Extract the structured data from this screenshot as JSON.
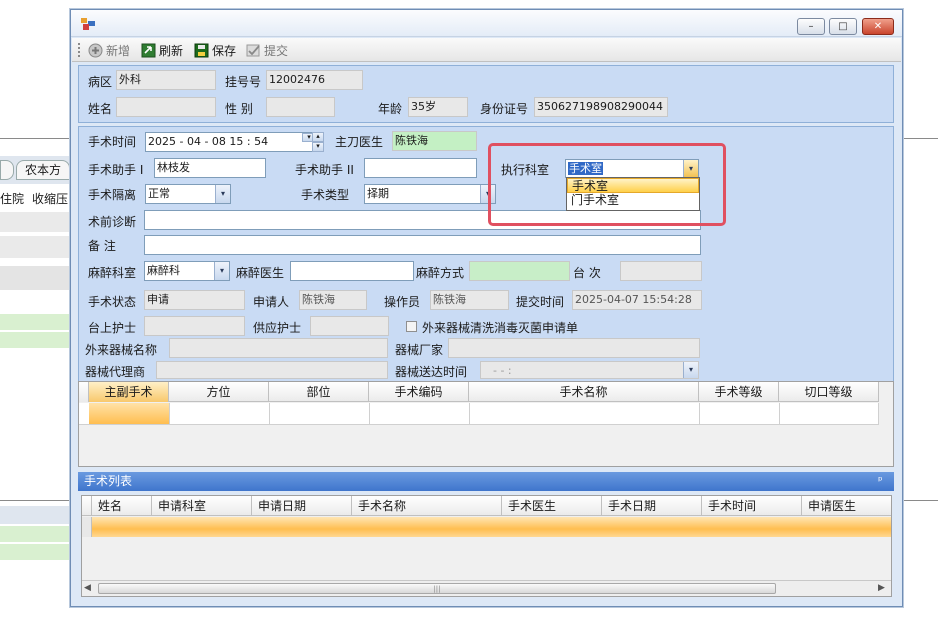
{
  "background": {
    "tab_label": "农本方",
    "row_labels": [
      "住院",
      "收缩压"
    ]
  },
  "window": {
    "controls": {
      "minimize": "–",
      "maximize": "□",
      "close": "✕"
    }
  },
  "toolbar": {
    "new_label": "新增",
    "refresh_label": "刷新",
    "save_label": "保存",
    "submit_label": "提交"
  },
  "patient": {
    "ward_label": "病区",
    "ward_value": "外科",
    "bed_label": "挂号号",
    "bed_value": "12002476",
    "name_label": "姓名",
    "name_value": "",
    "gender_label": "性  别",
    "gender_value": "",
    "age_label": "年龄",
    "age_value": "35岁",
    "id_label": "身份证号",
    "id_value": "350627198908290044"
  },
  "surgery": {
    "time_label": "手术时间",
    "time_value": "2025 - 04 - 08   15 : 54",
    "surgeon_label": "主刀医生",
    "surgeon_value": "陈铁海",
    "assistant1_label": "手术助手 I",
    "assistant1_value": "林枝发",
    "assistant2_label": "手术助手 II",
    "assistant2_value": "",
    "dept_label": "执行科室",
    "dept_value": "手术室",
    "dept_options": [
      "手术室",
      "门手术室"
    ],
    "isolation_label": "手术隔离",
    "isolation_value": "正常",
    "type_label": "手术类型",
    "type_value": "择期",
    "diagnosis_label": "术前诊断",
    "diagnosis_value": "",
    "remarks_label": "备    注",
    "remarks_value": "",
    "anes_dept_label": "麻醉科室",
    "anes_dept_value": "麻醉科",
    "anes_doctor_label": "麻醉医生",
    "anes_doctor_value": "",
    "anes_method_label": "麻醉方式",
    "anes_method_value": "",
    "table_no_label": "台  次",
    "table_no_value": "",
    "status_label": "手术状态",
    "status_value": "申请",
    "applicant_label": "申请人",
    "applicant_value": "陈铁海",
    "operator_label": "操作员",
    "operator_value": "陈铁海",
    "submit_time_label": "提交时间",
    "submit_time_value": "2025-04-07 15:54:28",
    "scrub_nurse_label": "台上护士",
    "scrub_nurse_value": "",
    "supply_nurse_label": "供应护士",
    "supply_nurse_value": "",
    "external_check_label": "外来器械清洗消毒灭菌申请单",
    "device_name_label": "外来器械名称",
    "device_name_value": "",
    "manufacturer_label": "器械厂家",
    "manufacturer_value": "",
    "agent_label": "器械代理商",
    "agent_value": "",
    "delivery_time_label": "器械送达时间",
    "delivery_time_value": "-  -    :"
  },
  "surgery_grid": {
    "columns": [
      "主副手术",
      "方位",
      "部位",
      "手术编码",
      "手术名称",
      "手术等级",
      "切口等级"
    ]
  },
  "surgery_list": {
    "title": "手术列表",
    "pin": "ᵖ",
    "columns": [
      "姓名",
      "申请科室",
      "申请日期",
      "手术名称",
      "手术医生",
      "手术日期",
      "手术时间",
      "申请医生"
    ],
    "scroll_thumb": "|||"
  },
  "colors": {
    "highlight": "#e05060",
    "selection": "#ffbe50",
    "panel_bar": "#3f75cc"
  }
}
